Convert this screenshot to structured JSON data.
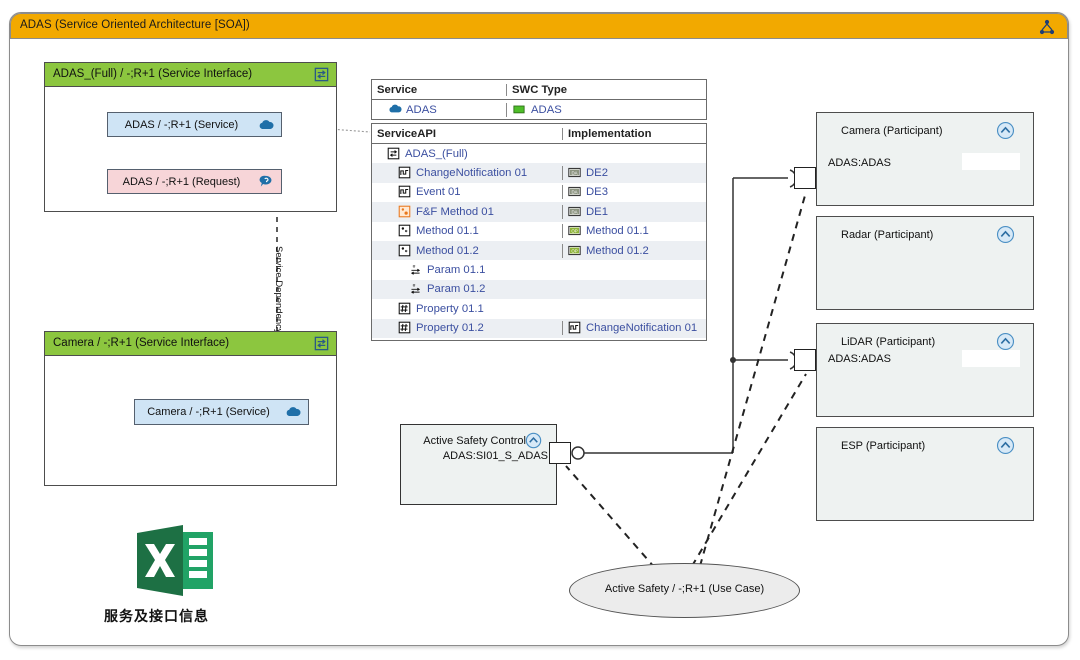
{
  "window": {
    "title": "ADAS (Service Oriented Architecture  [SOA])",
    "title_icon": "hierarchy-icon",
    "title_bar_color": "#f2a900"
  },
  "packages": [
    {
      "id": "adas-service-interface",
      "header": "ADAS_(Full) / -;R+1 (Service Interface)",
      "header_icon": "interface-exchange-icon",
      "header_color": "#8cc63f",
      "children": [
        {
          "id": "adas-service",
          "label": "ADAS / -;R+1 (Service)",
          "icon": "cloud-icon",
          "color": "#cfe4f5"
        },
        {
          "id": "adas-request",
          "label": "ADAS / -;R+1 (Request)",
          "icon": "request-balloon-icon",
          "color": "#f7d5d8"
        }
      ]
    },
    {
      "id": "camera-service-interface",
      "header": "Camera / -;R+1 (Service Interface)",
      "header_icon": "interface-exchange-icon",
      "header_color": "#8cc63f",
      "children": [
        {
          "id": "camera-service",
          "label": "Camera / -;R+1 (Service)",
          "icon": "cloud-icon",
          "color": "#cfe4f5"
        }
      ]
    }
  ],
  "connector_labels": {
    "service_dependency": "Service Dependency"
  },
  "service_table": {
    "columns": [
      "Service",
      "SWC Type",
      ""
    ],
    "rows": [
      {
        "service": "ADAS",
        "service_icon": "cloud-icon",
        "swc_type": "ADAS",
        "swc_icon": "green-square-icon",
        "extra": ""
      }
    ]
  },
  "api_table": {
    "columns": [
      "ServiceAPI",
      "Implementation"
    ],
    "rows": [
      {
        "name": "ADAS_(Full)",
        "icon": "interface-exchange-icon",
        "indent": 1,
        "impl": "",
        "impl_icon": ""
      },
      {
        "name": "ChangeNotification 01",
        "icon": "event-signal-icon",
        "indent": 2,
        "impl": "DE2",
        "impl_icon": "data-element-icon"
      },
      {
        "name": "Event 01",
        "icon": "event-signal-icon",
        "indent": 2,
        "impl": "DE3",
        "impl_icon": "data-element-icon"
      },
      {
        "name": "F&F Method 01",
        "icon": "ff-method-icon",
        "indent": 2,
        "impl": "DE1",
        "impl_icon": "data-element-icon"
      },
      {
        "name": "Method 01.1",
        "icon": "method-icon",
        "indent": 2,
        "impl": "Method 01.1",
        "impl_icon": "operation-icon"
      },
      {
        "name": "Method 01.2",
        "icon": "method-icon",
        "indent": 2,
        "impl": "Method 01.2",
        "impl_icon": "operation-icon"
      },
      {
        "name": "Param 01.1",
        "icon": "param-arrows-icon",
        "indent": 3,
        "impl": "",
        "impl_icon": ""
      },
      {
        "name": "Param 01.2",
        "icon": "param-arrows-icon",
        "indent": 3,
        "impl": "",
        "impl_icon": ""
      },
      {
        "name": "Property 01.1",
        "icon": "property-icon",
        "indent": 2,
        "impl": "",
        "impl_icon": ""
      },
      {
        "name": "Property 01.2",
        "icon": "property-icon",
        "indent": 2,
        "impl": "ChangeNotification 01",
        "impl_icon": "event-signal-icon"
      }
    ]
  },
  "participants": [
    {
      "id": "camera",
      "name": "Camera (Participant)",
      "instance": "ADAS:ADAS",
      "has_blank_field": true,
      "collapse_icon": "collapse-chevron-icon"
    },
    {
      "id": "radar",
      "name": "Radar (Participant)",
      "instance": "",
      "has_blank_field": false,
      "collapse_icon": "collapse-chevron-icon"
    },
    {
      "id": "lidar",
      "name": "LiDAR (Participant)",
      "instance": "ADAS:ADAS",
      "has_blank_field": true,
      "collapse_icon": "collapse-chevron-icon"
    },
    {
      "id": "esp",
      "name": "ESP (Participant)",
      "instance": "",
      "has_blank_field": false,
      "collapse_icon": "collapse-chevron-icon"
    }
  ],
  "active_safety_control": {
    "title": "Active Safety Control",
    "instance": "ADAS:SI01_S_ADAS",
    "collapse_icon": "collapse-chevron-icon"
  },
  "use_case": {
    "label": "Active Safety / -;R+1 (Use Case)"
  },
  "excel_note": {
    "icon": "excel-icon",
    "caption": "服务及接口信息"
  },
  "colors": {
    "title_bar": "#f2a900",
    "package_header": "#8cc63f",
    "service_fill": "#cfe4f5",
    "request_fill": "#f7d5d8",
    "participant_fill": "#eef2f1",
    "link_text": "#3b4fa0",
    "excel_green": "#1d7044"
  }
}
